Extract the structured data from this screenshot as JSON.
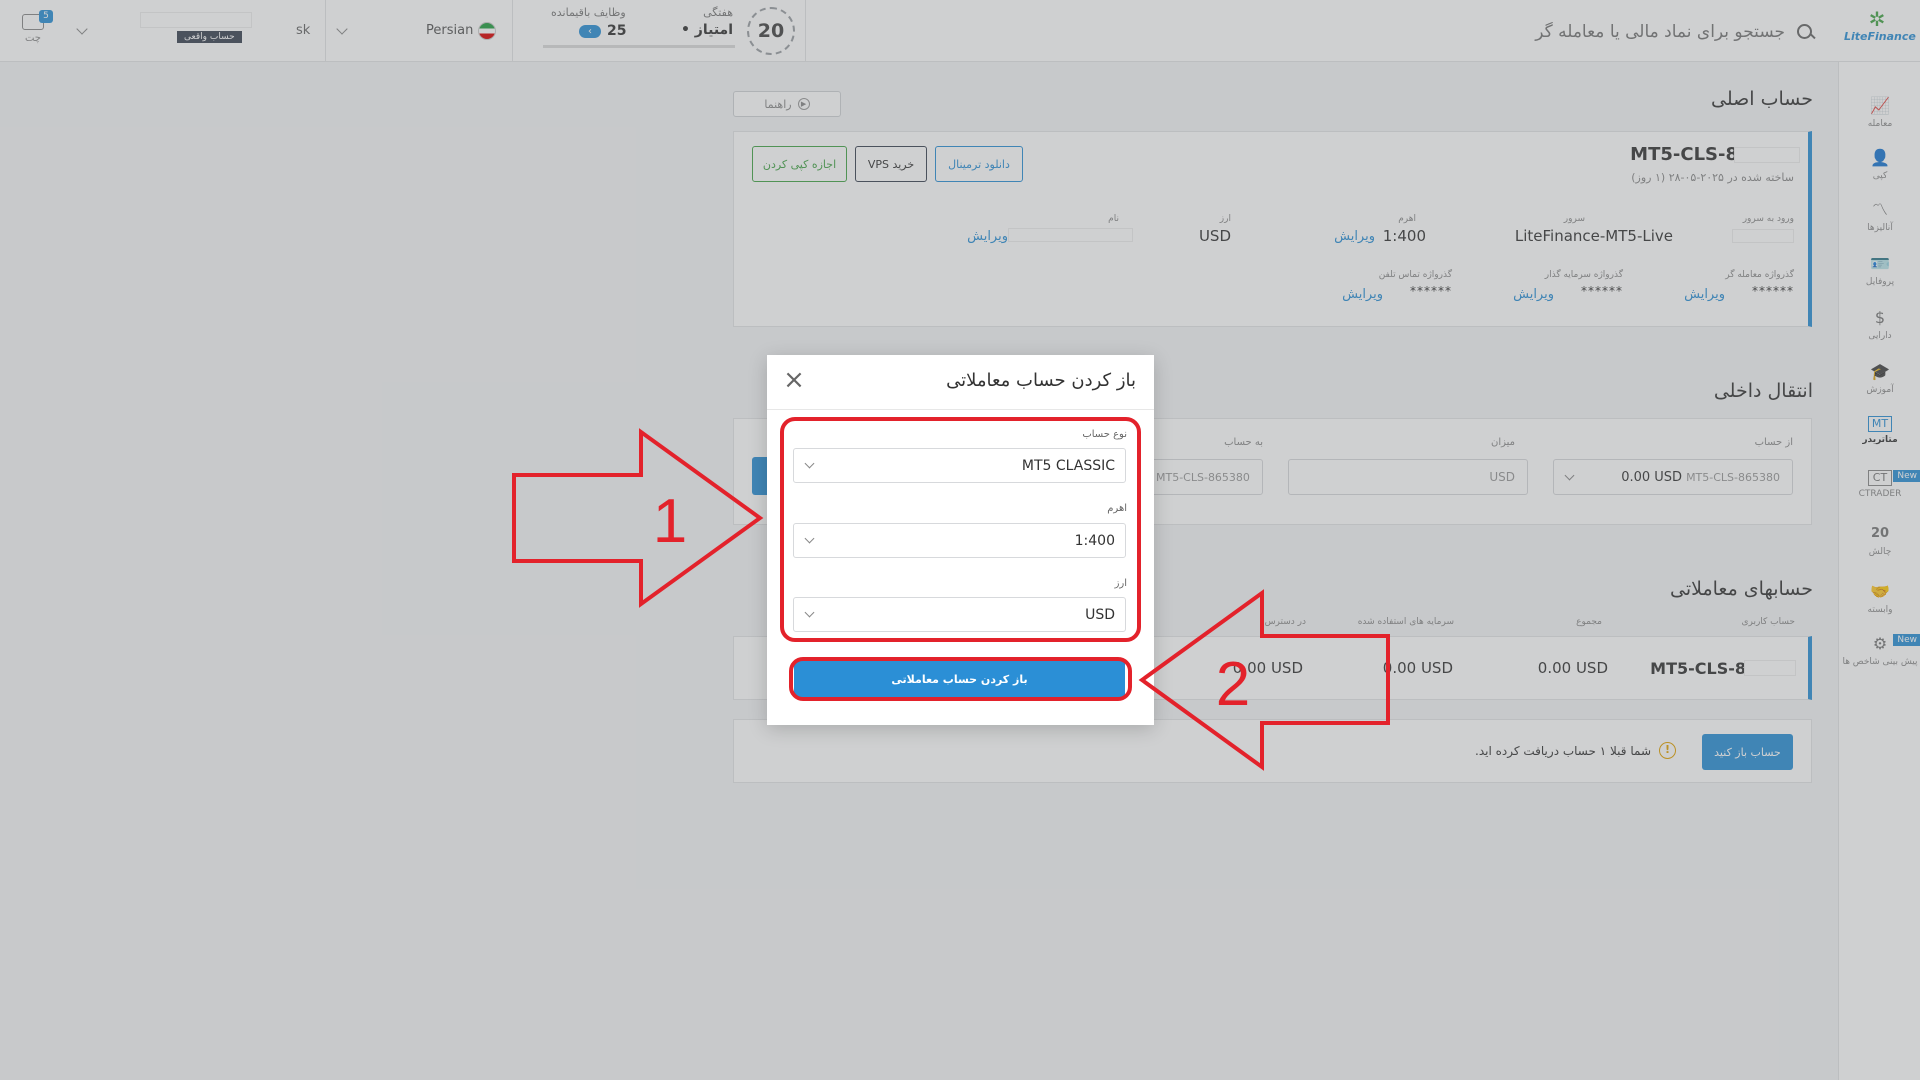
{
  "header": {
    "logo_text": "LiteFinance",
    "search_placeholder": "جستجو برای نماد مالی یا معامله گر",
    "level_label": "هفتگی",
    "level_value": "20",
    "level_points": "• امتیاز",
    "tasks_label": "وظایف باقیمانده",
    "tasks_count": "25",
    "language": "Persian",
    "user_short": "sk",
    "account_badge": "حساب واقعی",
    "chat_label": "چت",
    "chat_count": "5"
  },
  "sidebar": {
    "items": [
      {
        "label": "معامله",
        "icon": "chart-icon",
        "glyph": "📈"
      },
      {
        "label": "کپی",
        "icon": "user-icon",
        "glyph": "👤"
      },
      {
        "label": "آنالیزها",
        "icon": "analysis-icon",
        "glyph": "〽"
      },
      {
        "label": "پروفایل",
        "icon": "profile-card-icon",
        "glyph": "🪪"
      },
      {
        "label": "دارایی",
        "icon": "dollar-icon",
        "glyph": "$"
      },
      {
        "label": "آموزش",
        "icon": "graduation-cap-icon",
        "glyph": "🎓"
      },
      {
        "label": "متاتریدر",
        "icon": "metatrader-icon",
        "glyph": "MT"
      },
      {
        "label": "CTRADER",
        "icon": "ctrader-icon",
        "glyph": "CT"
      },
      {
        "label": "چالش",
        "icon": "laurel-icon",
        "glyph": "20"
      },
      {
        "label": "وابسته",
        "icon": "handshake-icon",
        "glyph": "🤝"
      },
      {
        "label": "پیش بینی شاخص ها",
        "icon": "forecast-icon",
        "glyph": "⚙"
      }
    ],
    "new_badge": "New"
  },
  "main_account": {
    "title": "حساب اصلی",
    "guide_label": "راهنما",
    "account_id": "MT5-CLS-8",
    "created": "ساخته شده در ۲۰۲۵-۰۵-۲۸ (۱ روز)",
    "buttons": {
      "download": "دانلود ترمینال",
      "vps": "خرید VPS",
      "copy": "اجازه کپی کردن"
    },
    "fields": {
      "server_login_label": "ورود به سرور",
      "server_label": "سرور",
      "server_value": "LiteFinance-MT5-Live",
      "leverage_label": "اهرم",
      "leverage_value": "1:400",
      "currency_label": "ارز",
      "currency_value": "USD",
      "name_label": "نام",
      "edit_label": "ویرایش",
      "trader_pass_label": "گذرواژه معامله گر",
      "investor_pass_label": "گذرواژه سرمایه گذار",
      "phone_pass_label": "گذرواژه تماس تلفن",
      "stars": "******"
    }
  },
  "transfer": {
    "title": "انتقال داخلی",
    "from_label": "از حساب",
    "from_value": "0.00 USD",
    "from_account": "MT5-CLS-865380",
    "amount_label": "میزان",
    "amount_currency": "USD",
    "to_label": "به حساب",
    "to_account": "MT5-CLS-865380"
  },
  "trading_accounts": {
    "title": "حسابهای معاملاتی",
    "col_account": "حساب کاربری",
    "col_total": "مجموع",
    "col_used": "سرمایه های استفاده شده",
    "col_available": "در دسترس",
    "row_account": "MT5-CLS-8",
    "row_total": "0.00 USD",
    "row_used": "0.00 USD",
    "row_available": "0.00 USD",
    "open_btn": "حساب باز کنید",
    "notice": "شما قبلا ۱ حساب دریافت کرده اید."
  },
  "modal": {
    "title": "باز کردن حساب معاملاتی",
    "type_label": "نوع حساب",
    "type_value": "MT5 CLASSIC",
    "leverage_label": "اهرم",
    "leverage_value": "1:400",
    "currency_label": "ارز",
    "currency_value": "USD",
    "submit": "باز کردن حساب معاملاتی"
  },
  "annotations": {
    "step1": "1",
    "step2": "2",
    "color": "#e3222b"
  }
}
